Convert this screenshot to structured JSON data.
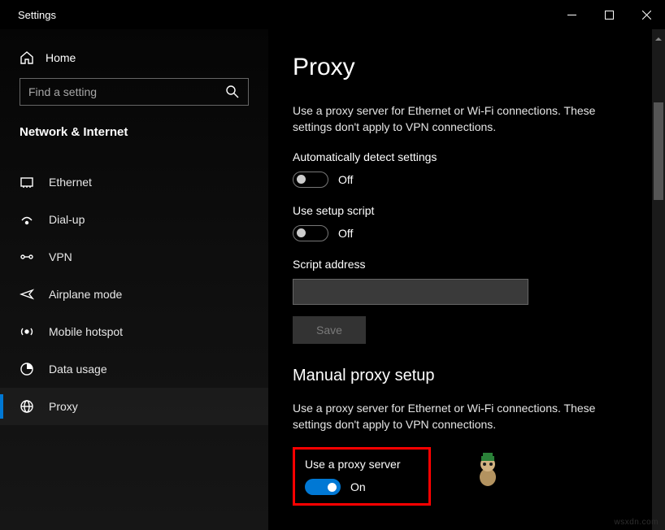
{
  "app": {
    "title": "Settings"
  },
  "sidebar": {
    "home": "Home",
    "search_placeholder": "Find a setting",
    "section": "Network & Internet",
    "items": [
      {
        "label": "Ethernet"
      },
      {
        "label": "Dial-up"
      },
      {
        "label": "VPN"
      },
      {
        "label": "Airplane mode"
      },
      {
        "label": "Mobile hotspot"
      },
      {
        "label": "Data usage"
      },
      {
        "label": "Proxy"
      }
    ]
  },
  "page": {
    "title": "Proxy",
    "auto_desc": "Use a proxy server for Ethernet or Wi-Fi connections. These settings don't apply to VPN connections.",
    "auto_detect_label": "Automatically detect settings",
    "auto_detect_state": "Off",
    "use_script_label": "Use setup script",
    "use_script_state": "Off",
    "script_address_label": "Script address",
    "script_address_value": "",
    "save_label": "Save",
    "manual_heading": "Manual proxy setup",
    "manual_desc": "Use a proxy server for Ethernet or Wi-Fi connections. These settings don't apply to VPN connections.",
    "use_proxy_label": "Use a proxy server",
    "use_proxy_state": "On"
  },
  "watermark": "wsxdn.com"
}
